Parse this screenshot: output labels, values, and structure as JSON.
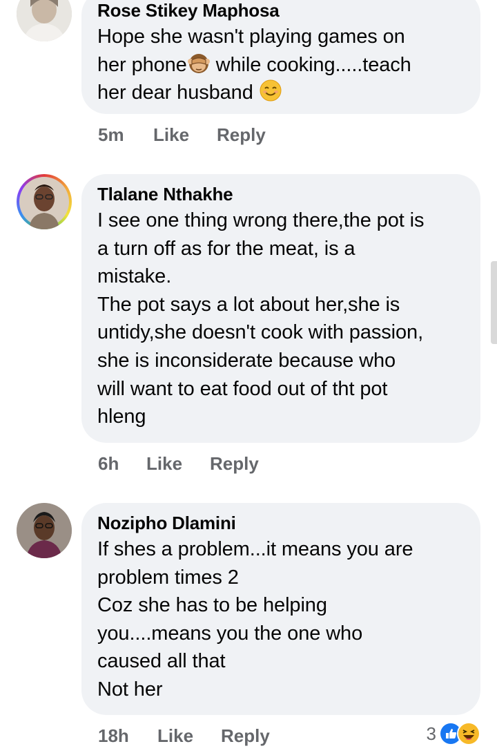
{
  "comments": [
    {
      "author": "Rose Stikey Maphosa",
      "lines": [
        "Hope she wasn't playing games on",
        "her phone",
        " while cooking.....teach",
        "her dear husband "
      ],
      "time": "5m",
      "like_label": "Like",
      "reply_label": "Reply"
    },
    {
      "author": "Tlalane Nthakhe",
      "lines": [
        "I see one thing wrong there,the pot is",
        "a turn off as for the meat, is a",
        "mistake.",
        "The pot says a lot about her,she is",
        "untidy,she doesn't cook with passion,",
        "she is inconsiderate because who",
        "will want to eat food out of tht pot",
        "hleng"
      ],
      "time": "6h",
      "like_label": "Like",
      "reply_label": "Reply"
    },
    {
      "author": "Nozipho Dlamini",
      "lines": [
        "If shes a problem...it means you are",
        "problem times 2",
        "Coz she has to be helping",
        "you....means you the one who",
        "caused all that",
        "Not her"
      ],
      "time": "18h",
      "like_label": "Like",
      "reply_label": "Reply",
      "reaction_count": "3",
      "reaction_icons": [
        "like-icon",
        "haha-icon"
      ]
    }
  ],
  "emoji_icons": [
    "see-no-evil-monkey-icon",
    "smiling-face-icon"
  ],
  "colors": {
    "bubble": "#f0f2f5",
    "action_text": "#65676b",
    "like_blue": "#1877f2",
    "haha_yellow": "#f7b928"
  }
}
